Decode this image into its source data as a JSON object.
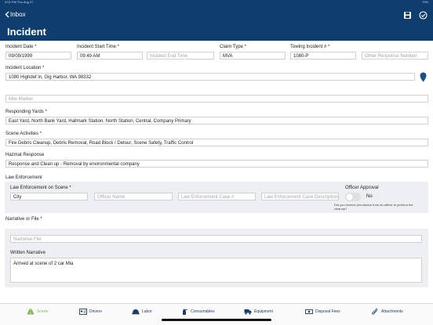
{
  "status_bar": {
    "left": "3:02 PM  Thu Aug 27",
    "right": "70%"
  },
  "header": {
    "back_label": "Inbox",
    "title": "Incident",
    "save_icon": "save-icon",
    "check_icon": "check-circle-icon"
  },
  "fields": {
    "incident_date": {
      "label": "Incident Date *",
      "value": "09/09/1999"
    },
    "incident_start_time": {
      "label": "Incident Start Time *",
      "value": "09:49 AM"
    },
    "incident_end_time": {
      "placeholder": "Incident End Time"
    },
    "claim_type": {
      "label": "Claim Type *",
      "value": "MVA"
    },
    "towing_incident": {
      "label": "Towing Incident # *",
      "value": "1080-P"
    },
    "other_response_number": {
      "placeholder": "Other Response Number"
    },
    "incident_location": {
      "label": "Incident Location *",
      "value": "1080 Highdef ln, Gig Harbor, WA 98332"
    },
    "mile_marker": {
      "placeholder": "Mile Marker"
    },
    "responding_yards": {
      "label": "Responding Yards *",
      "value": "East Yard, North Bank Yard, Hallmark Station, North Station, Central, Company Primary"
    },
    "scene_activities": {
      "label": "Scene Activities *",
      "value": "Fire Debris Cleanup, Debris Removal, Road Block / Detour, Scene Safety, Traffic Control"
    },
    "hazmat_response": {
      "label": "Hazmat Response",
      "value": "Response and Clean up - Removal by environmental company"
    }
  },
  "law_enforcement": {
    "section_label": "Law Enforcement",
    "on_scene_label": "Law Enforcement on Scene *",
    "on_scene_value": "City",
    "officer_name_placeholder": "Officer Name",
    "case_number_placeholder": "Law Enforcement Case #",
    "case_description_placeholder": "Law Enforcement Case Description",
    "officer_approval_label": "Officer Approval",
    "officer_approval_value": "No",
    "officer_approval_on": false,
    "officer_note": "Did you receive permission from an officer to perform the cleanup?"
  },
  "narrative": {
    "section_label": "Narrative or File *",
    "file_placeholder": "Narrative File",
    "written_label": "Written Narrative",
    "written_value": "Arrived at scene of 2 car Mia"
  },
  "tabs": [
    {
      "label": "Scene",
      "icon": "road-icon",
      "active": true
    },
    {
      "label": "Drivers",
      "icon": "id-card-icon",
      "active": false
    },
    {
      "label": "Labor",
      "icon": "hard-hat-icon",
      "active": false
    },
    {
      "label": "Consumables",
      "icon": "spray-bottle-icon",
      "active": false
    },
    {
      "label": "Equipment",
      "icon": "truck-icon",
      "active": false
    },
    {
      "label": "Disposal Fees",
      "icon": "money-icon",
      "active": false
    },
    {
      "label": "Attachments",
      "icon": "paperclip-icon",
      "active": false
    }
  ],
  "colors": {
    "header": "#0f3d6e",
    "accent_tab": "#8db35a",
    "tab_text": "#1f3c66",
    "location_pin": "#1f4f86"
  }
}
